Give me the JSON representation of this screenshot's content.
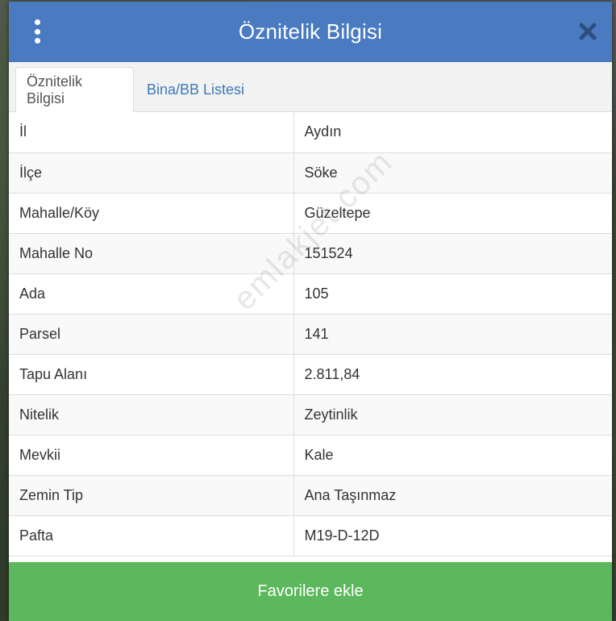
{
  "header": {
    "title": "Öznitelik Bilgisi"
  },
  "tabs": [
    {
      "label": "Öznitelik Bilgisi",
      "active": true
    },
    {
      "label": "Bina/BB Listesi",
      "active": false
    }
  ],
  "attributes": [
    {
      "key": "İl",
      "value": "Aydın"
    },
    {
      "key": "İlçe",
      "value": "Söke"
    },
    {
      "key": "Mahalle/Köy",
      "value": "Güzeltepe"
    },
    {
      "key": "Mahalle No",
      "value": "151524"
    },
    {
      "key": "Ada",
      "value": "105"
    },
    {
      "key": "Parsel",
      "value": "141"
    },
    {
      "key": "Tapu Alanı",
      "value": "2.811,84"
    },
    {
      "key": "Nitelik",
      "value": "Zeytinlik"
    },
    {
      "key": "Mevkii",
      "value": "Kale"
    },
    {
      "key": "Zemin Tip",
      "value": "Ana Taşınmaz"
    },
    {
      "key": "Pafta",
      "value": "M19-D-12D"
    }
  ],
  "footer": {
    "favorite_label": "Favorilere ekle"
  },
  "watermark": "emlakjet.com",
  "colors": {
    "header": "#4a7ac0",
    "button": "#5cb85c",
    "tab_link": "#3d7ab8"
  },
  "icons": {
    "menu": "vertical-dots-icon",
    "close": "close-icon"
  }
}
